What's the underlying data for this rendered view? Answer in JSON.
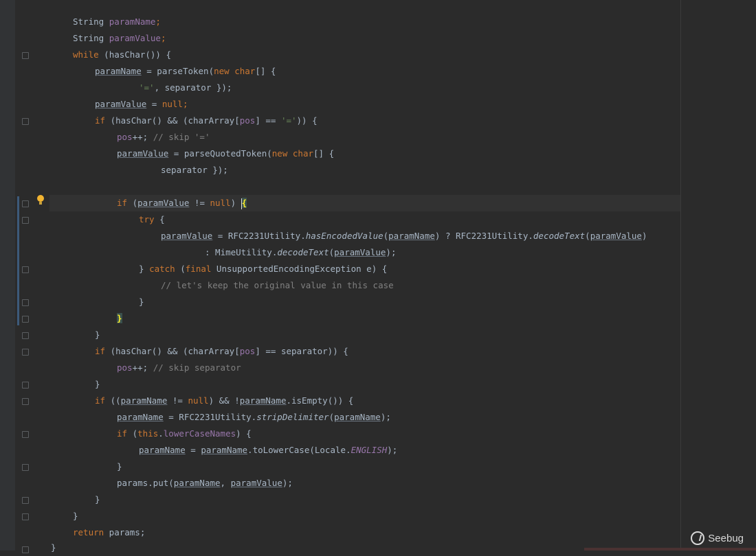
{
  "editor": {
    "language": "Java",
    "theme_colors": {
      "background": "#2b2b2b",
      "keyword": "#cc7832",
      "field": "#9876aa",
      "string": "#6a8759",
      "comment": "#808080",
      "text": "#a9b7c6"
    }
  },
  "code": {
    "l1_a": "String ",
    "l1_b": "paramName",
    "l1_c": ";",
    "l2_a": "String ",
    "l2_b": "paramValue",
    "l2_c": ";",
    "l3_kw": "while",
    "l3_rest": " (hasChar()) {",
    "l4_a": "paramName",
    "l4_b": " = parseToken(",
    "l4_kw1": "new",
    "l4_kw2": "char",
    "l4_c": "[] {",
    "l5_str": "'='",
    "l5_rest": ", separator });",
    "l6_a": "paramValue",
    "l6_b": " = ",
    "l6_kw": "null",
    "l6_c": ";",
    "l7_kw": "if",
    "l7_a": " (hasChar() && (charArray[",
    "l7_fld": "pos",
    "l7_b": "] == ",
    "l7_str": "'='",
    "l7_c": ")) {",
    "l8_fld": "pos",
    "l8_a": "++; ",
    "l8_cmt": "// skip '='",
    "l9_a": "paramValue",
    "l9_b": " = parseQuotedToken(",
    "l9_kw1": "new",
    "l9_kw2": "char",
    "l9_c": "[] {",
    "l10": "separator });",
    "l12_kw": "if",
    "l12_a": " (",
    "l12_var": "paramValue",
    "l12_b": " != ",
    "l12_kw2": "null",
    "l12_c": ") ",
    "l12_brace": "{",
    "l13_kw": "try",
    "l13_a": " {",
    "l14_a": "paramValue",
    "l14_b": " = RFC2231Utility.",
    "l14_m1": "hasEncodedValue",
    "l14_c": "(",
    "l14_v1": "paramName",
    "l14_d": ") ? RFC2231Utility.",
    "l14_m2": "decodeText",
    "l14_e": "(",
    "l14_v2": "paramValue",
    "l14_f": ")",
    "l15_a": ": MimeUtility.",
    "l15_m": "decodeText",
    "l15_b": "(",
    "l15_v": "paramValue",
    "l15_c": ");",
    "l16_a": "} ",
    "l16_kw1": "catch",
    "l16_b": " (",
    "l16_kw2": "final",
    "l16_c": " UnsupportedEncodingException e) {",
    "l17_cmt": "// let's keep the original value in this case",
    "l18": "}",
    "l19_brace": "}",
    "l20": "}",
    "l21_kw": "if",
    "l21_a": " (hasChar() && (charArray[",
    "l21_fld": "pos",
    "l21_b": "] == separator)) {",
    "l22_fld": "pos",
    "l22_a": "++; ",
    "l22_cmt": "// skip separator",
    "l23": "}",
    "l24_kw": "if",
    "l24_a": " ((",
    "l24_v1": "paramName",
    "l24_b": " != ",
    "l24_kw2": "null",
    "l24_c": ") && !",
    "l24_v2": "paramName",
    "l24_d": ".isEmpty()) {",
    "l25_v1": "paramName",
    "l25_a": " = RFC2231Utility.",
    "l25_m": "stripDelimiter",
    "l25_b": "(",
    "l25_v2": "paramName",
    "l25_c": ");",
    "l26_kw1": "if",
    "l26_a": " (",
    "l26_kw2": "this",
    "l26_b": ".",
    "l26_fld": "lowerCaseNames",
    "l26_c": ") {",
    "l27_v1": "paramName",
    "l27_a": " = ",
    "l27_v2": "paramName",
    "l27_b": ".toLowerCase(Locale.",
    "l27_fld": "ENGLISH",
    "l27_c": ");",
    "l28": "}",
    "l29_a": "params.put(",
    "l29_v1": "paramName",
    "l29_b": ", ",
    "l29_v2": "paramValue",
    "l29_c": ");",
    "l30": "}",
    "l31": "}",
    "l32_kw": "return",
    "l32_a": " params;",
    "l33": "}"
  },
  "watermark": {
    "text": "Seebug"
  }
}
